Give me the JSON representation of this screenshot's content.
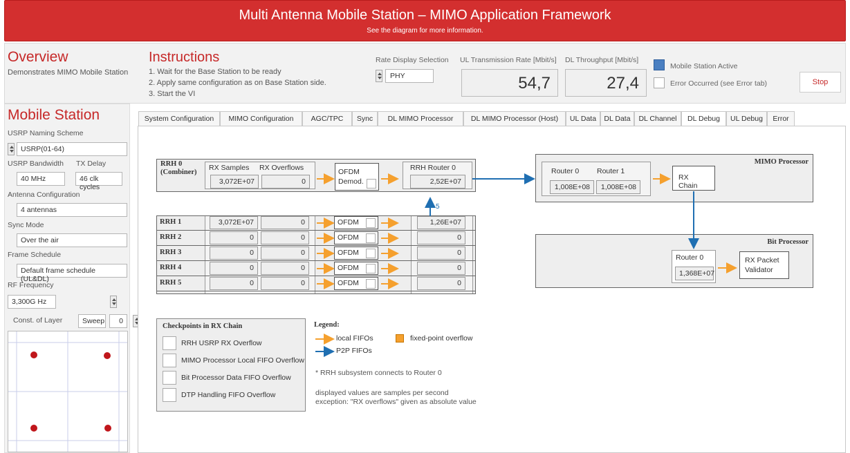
{
  "banner": {
    "title": "Multi Antenna Mobile Station – MIMO Application Framework",
    "subtitle": "See the diagram for more information."
  },
  "overview": {
    "title": "Overview",
    "desc": "Demonstrates MIMO Mobile Station"
  },
  "instructions": {
    "title": "Instructions",
    "steps": [
      "1. Wait for the Base Station to be ready",
      "2. Apply same configuration as on Base Station side.",
      "3. Start the VI"
    ]
  },
  "rate_display": {
    "label": "Rate Display Selection",
    "value": "PHY"
  },
  "ul_rate": {
    "label": "UL Transmission Rate [Mbit/s]",
    "value": "54,7"
  },
  "dl_throughput": {
    "label": "DL Throughput [Mbit/s]",
    "value": "27,4"
  },
  "status": {
    "active_label": "Mobile Station Active",
    "error_label": "Error Occurred (see Error tab)",
    "stop_label": "Stop",
    "active_color": "#4a7fc1"
  },
  "mobile": {
    "title": "Mobile Station",
    "naming_label": "USRP Naming Scheme",
    "naming_value": "USRP(01-64)",
    "bw_label": "USRP Bandwidth",
    "bw_value": "40 MHz",
    "tx_label": "TX Delay",
    "tx_value": "46 clk cycles",
    "antenna_label": "Antenna Configuration",
    "antenna_value": "4 antennas",
    "sync_label": "Sync Mode",
    "sync_value": "Over the air",
    "frame_label": "Frame Schedule",
    "frame_value": "Default frame schedule (UL&DL)",
    "rf_label": "RF Frequency",
    "rf_value": "3,300G Hz",
    "const_label": "Const. of Layer",
    "sweep_label": "Sweep",
    "layer_value": "0"
  },
  "tabs": [
    "System Configuration",
    "MIMO Configuration",
    "AGC/TPC",
    "Sync",
    "DL MIMO Processor",
    "DL MIMO Processor (Host)",
    "UL Data",
    "DL Data",
    "DL Channel",
    "DL Debug",
    "UL Debug",
    "Error"
  ],
  "active_tab": "DL Debug",
  "rrh0": {
    "name_line1": "RRH 0",
    "name_line2": "(Combiner)",
    "rx_samples_label": "RX Samples",
    "rx_overflows_label": "RX Overflows",
    "rx_samples": "3,072E+07",
    "rx_overflows": "0",
    "ofdm_label": "OFDM",
    "demod_label": "Demod.",
    "router_label": "RRH Router 0",
    "router_value": "2,52E+07"
  },
  "link_count": "5",
  "rrh_rows": [
    {
      "name": "RRH 1",
      "samples": "3,072E+07",
      "overflows": "0",
      "ofdm": "OFDM",
      "router": "1,26E+07"
    },
    {
      "name": "RRH 2",
      "samples": "0",
      "overflows": "0",
      "ofdm": "OFDM",
      "router": "0"
    },
    {
      "name": "RRH 3",
      "samples": "0",
      "overflows": "0",
      "ofdm": "OFDM",
      "router": "0"
    },
    {
      "name": "RRH 4",
      "samples": "0",
      "overflows": "0",
      "ofdm": "OFDM",
      "router": "0"
    },
    {
      "name": "RRH 5",
      "samples": "0",
      "overflows": "0",
      "ofdm": "OFDM",
      "router": "0"
    }
  ],
  "mimo": {
    "title": "MIMO Processor",
    "router0_label": "Router 0",
    "router1_label": "Router 1",
    "router0_value": "1,008E+08",
    "router1_value": "1,008E+08",
    "rx_chain": "RX Chain"
  },
  "bitproc": {
    "title": "Bit Processor",
    "router0_label": "Router 0",
    "router0_value": "1,368E+07",
    "validator": "RX Packet Validator"
  },
  "checkpoints": {
    "title": "Checkpoints in RX Chain",
    "items": [
      "RRH USRP RX Overflow",
      "MIMO Processor Local FIFO Overflow",
      "Bit Processor Data FIFO Overflow",
      "DTP Handling FIFO Overflow"
    ]
  },
  "legend": {
    "title": "Legend:",
    "local": "local FIFOs",
    "p2p": "P2P FIFOs",
    "fixed": "fixed-point overflow",
    "note1": "* RRH subsystem connects to Router 0",
    "note2": "displayed values are samples per second",
    "note3": "exception: \"RX overflows\" given as absolute value",
    "local_color": "#f5a02e",
    "p2p_color": "#1f6fb2",
    "fixed_color": "#f5a02e"
  }
}
